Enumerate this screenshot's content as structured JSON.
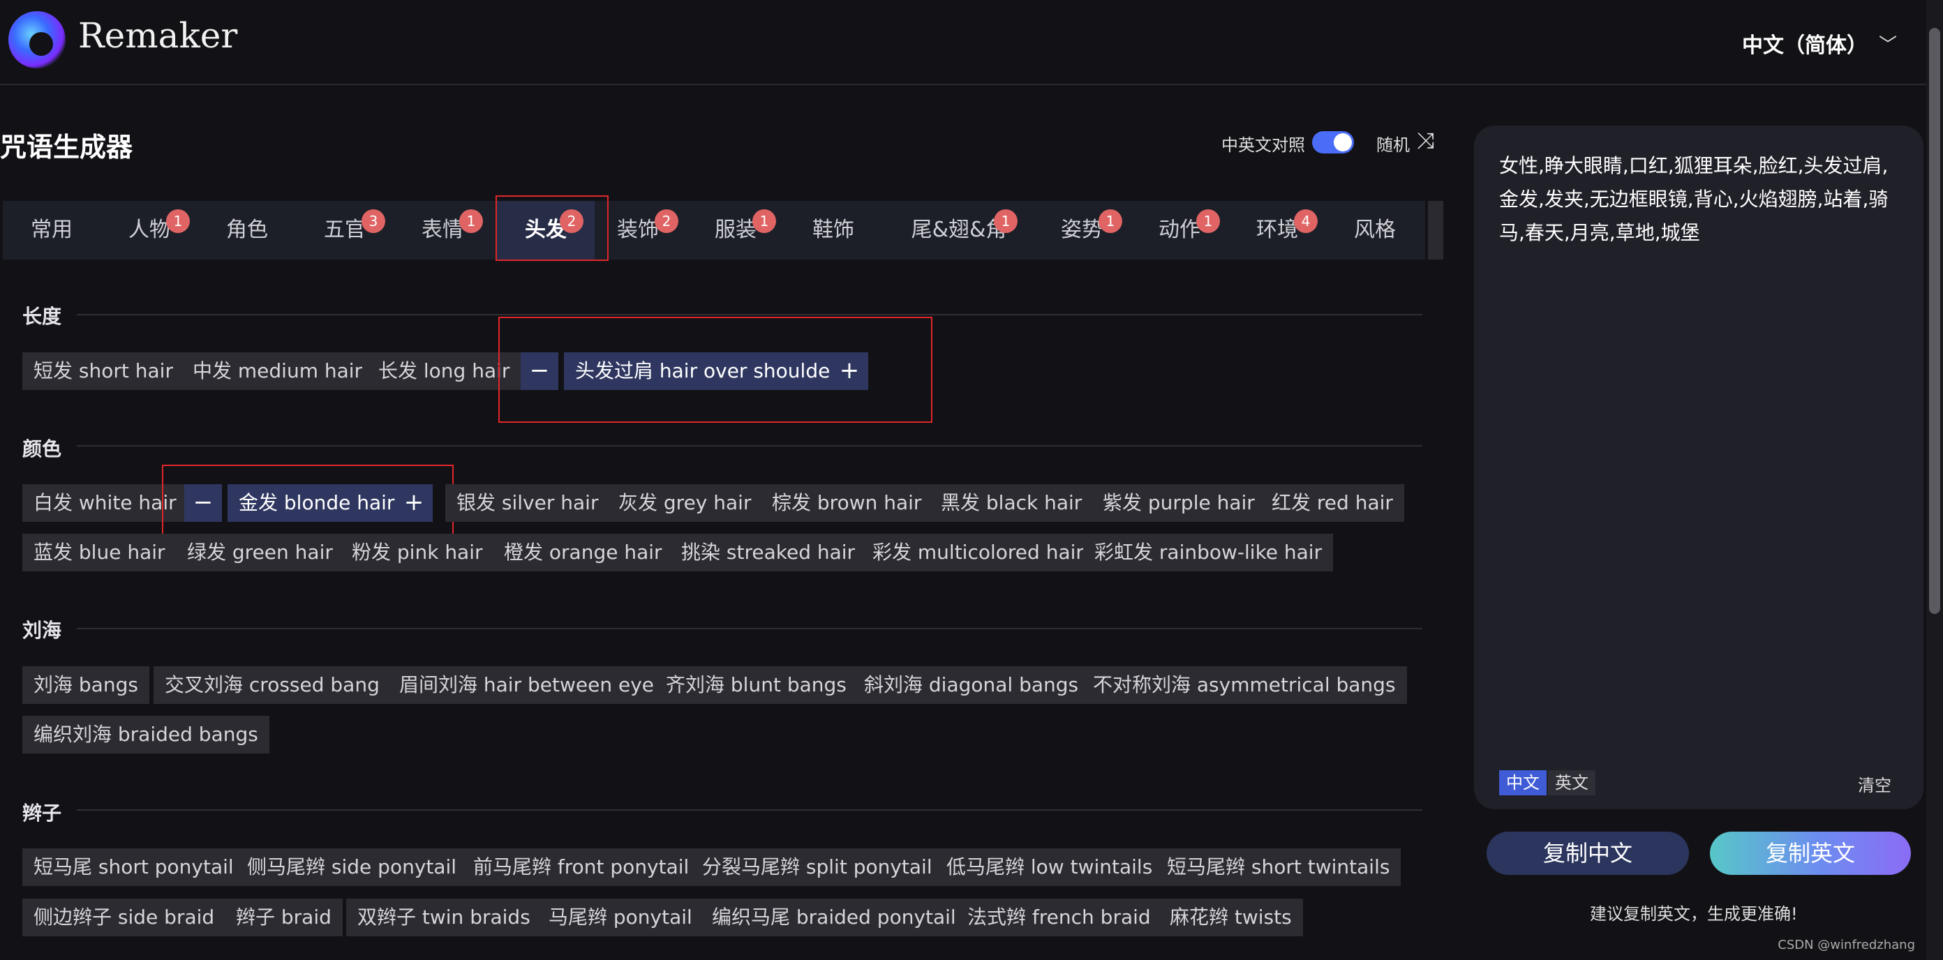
{
  "header": {
    "brand": "Remaker",
    "language": "中文（简体）",
    "language_chevron": "﹀"
  },
  "generator": {
    "title": "咒语生成器",
    "bilingual_label": "中英文对照",
    "random_label": "随机",
    "shuffle_icon": "⤨",
    "bilingual_on": true
  },
  "tabs": [
    {
      "label": "常用"
    },
    {
      "label": "人物",
      "badge": "1"
    },
    {
      "label": "角色"
    },
    {
      "label": "五官",
      "badge": "3"
    },
    {
      "label": "表情",
      "badge": "1"
    },
    {
      "label": "头发",
      "badge": "2",
      "active": true
    },
    {
      "label": "装饰",
      "badge": "2"
    },
    {
      "label": "服装",
      "badge": "1"
    },
    {
      "label": "鞋饰"
    },
    {
      "label": "尾&翅&角",
      "badge": "1"
    },
    {
      "label": "姿势",
      "badge": "1"
    },
    {
      "label": "动作",
      "badge": "1"
    },
    {
      "label": "环境",
      "badge": "4"
    },
    {
      "label": "风格"
    }
  ],
  "sections": {
    "length": {
      "title": "长度",
      "chips": [
        "短发 short hair",
        "中发 medium hair",
        "长发 long hair",
        "头发过肩 hair over shoulder"
      ]
    },
    "color": {
      "title": "颜色",
      "chips": [
        "白发 white hair",
        "金发 blonde hair",
        "银发 silver hair",
        "灰发 grey hair",
        "棕发 brown hair",
        "黑发 black hair",
        "紫发 purple hair",
        "红发 red hair",
        "蓝发 blue hair",
        "绿发 green hair",
        "粉发 pink hair",
        "橙发 orange hair",
        "挑染 streaked hair",
        "彩发 multicolored hair",
        "彩虹发 rainbow-like hair"
      ]
    },
    "bangs": {
      "title": "刘海",
      "chips": [
        "刘海 bangs",
        "交叉刘海 crossed bang",
        "眉间刘海 hair between eye",
        "齐刘海 blunt bangs",
        "斜刘海 diagonal bangs",
        "不对称刘海 asymmetrical bangs",
        "编织刘海 braided bangs"
      ]
    },
    "braids": {
      "title": "辫子",
      "chips": [
        "短马尾 short ponytail",
        "侧马尾辫 side ponytail",
        "前马尾辫 front ponytail",
        "分裂马尾辫 split ponytail",
        "低马尾辫 low twintails",
        "短马尾辫 short twintails",
        "侧边辫子 side braid",
        "辫子 braid",
        "双辫子 twin braids",
        "马尾辫 ponytail",
        "编织马尾 braided ponytail",
        "法式辫 french braid",
        "麻花辫 twists"
      ]
    }
  },
  "stepper": {
    "minus": "−",
    "plus": "+"
  },
  "panel": {
    "prompt": "女性,睁大眼睛,口红,狐狸耳朵,脸红,头发过肩,金发,发夹,无边框眼镜,背心,火焰翅膀,站着,骑马,春天,月亮,草地,城堡",
    "tab_cn": "中文",
    "tab_en": "英文",
    "clear": "清空",
    "copy_cn": "复制中文",
    "copy_en": "复制英文",
    "tip": "建议复制英文，生成更准确!"
  },
  "watermark": "CSDN @winfredzhang"
}
